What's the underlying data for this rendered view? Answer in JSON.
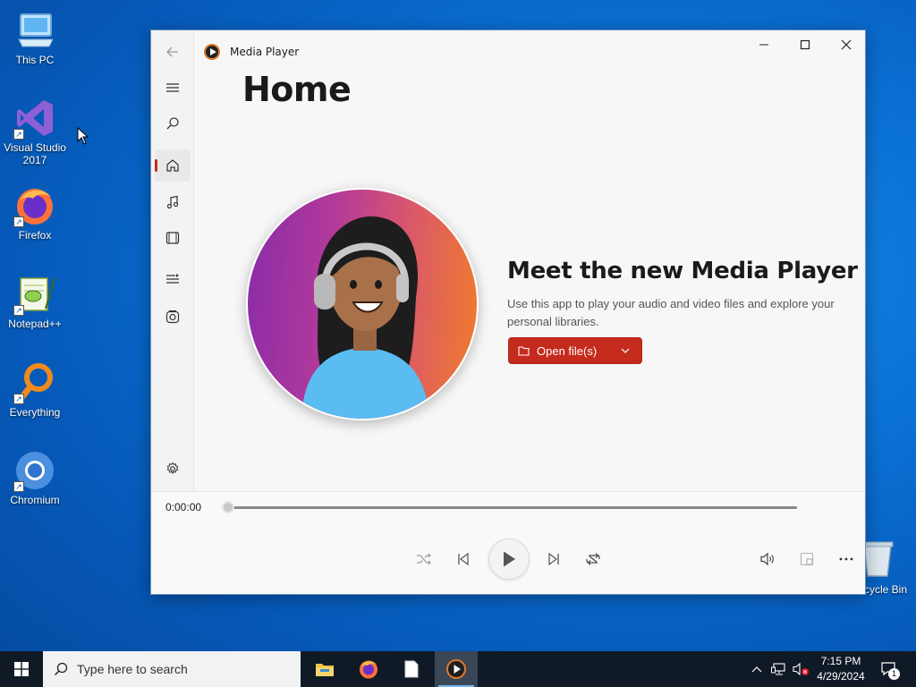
{
  "desktop": {
    "icons": [
      {
        "label": "This PC"
      },
      {
        "label": "Visual Studio 2017"
      },
      {
        "label": "Firefox"
      },
      {
        "label": "Notepad++"
      },
      {
        "label": "Everything"
      },
      {
        "label": "Chromium"
      }
    ],
    "recycle_bin_label": "cycle Bin"
  },
  "window": {
    "app_title": "Media Player",
    "page_title": "Home",
    "controls": {
      "minimize": "—",
      "maximize": "☐",
      "close": "✕"
    },
    "rail": [
      {
        "name": "back",
        "icon": "back-arrow-icon"
      },
      {
        "name": "menu",
        "icon": "hamburger-icon"
      },
      {
        "name": "search",
        "icon": "search-icon"
      },
      {
        "name": "home",
        "icon": "home-icon",
        "active": true
      },
      {
        "name": "music",
        "icon": "music-note-icon"
      },
      {
        "name": "video",
        "icon": "film-icon"
      },
      {
        "name": "play-queue",
        "icon": "playlist-icon"
      },
      {
        "name": "playlists",
        "icon": "playlists-icon"
      },
      {
        "name": "settings",
        "icon": "gear-icon"
      }
    ],
    "hero": {
      "heading": "Meet the new Media Player",
      "description": "Use this app to play your audio and video files and explore your personal libraries.",
      "open_button_label": "Open file(s)"
    },
    "player": {
      "time": "0:00:00",
      "progress": 0
    }
  },
  "taskbar": {
    "search_placeholder": "Type here to search",
    "time": "7:15 PM",
    "date": "4/29/2024",
    "notification_count": "1"
  },
  "colors": {
    "accent": "#c42b1c",
    "desktop_blue": "#0b73d8",
    "taskbar": "#101a27"
  }
}
